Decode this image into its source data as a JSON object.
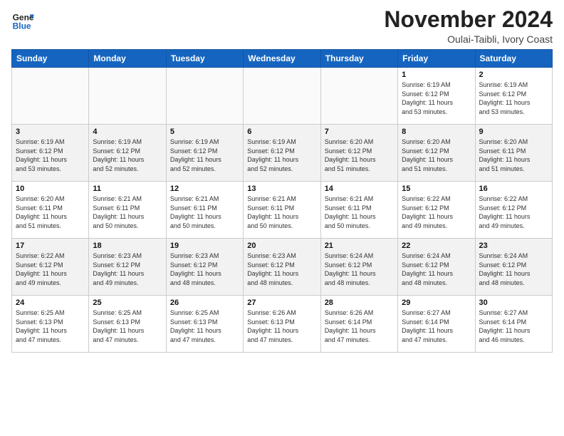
{
  "header": {
    "logo_line1": "General",
    "logo_line2": "Blue",
    "month": "November 2024",
    "location": "Oulai-Taibli, Ivory Coast"
  },
  "weekdays": [
    "Sunday",
    "Monday",
    "Tuesday",
    "Wednesday",
    "Thursday",
    "Friday",
    "Saturday"
  ],
  "weeks": [
    [
      {
        "day": "",
        "info": ""
      },
      {
        "day": "",
        "info": ""
      },
      {
        "day": "",
        "info": ""
      },
      {
        "day": "",
        "info": ""
      },
      {
        "day": "",
        "info": ""
      },
      {
        "day": "1",
        "info": "Sunrise: 6:19 AM\nSunset: 6:12 PM\nDaylight: 11 hours\nand 53 minutes."
      },
      {
        "day": "2",
        "info": "Sunrise: 6:19 AM\nSunset: 6:12 PM\nDaylight: 11 hours\nand 53 minutes."
      }
    ],
    [
      {
        "day": "3",
        "info": "Sunrise: 6:19 AM\nSunset: 6:12 PM\nDaylight: 11 hours\nand 53 minutes."
      },
      {
        "day": "4",
        "info": "Sunrise: 6:19 AM\nSunset: 6:12 PM\nDaylight: 11 hours\nand 52 minutes."
      },
      {
        "day": "5",
        "info": "Sunrise: 6:19 AM\nSunset: 6:12 PM\nDaylight: 11 hours\nand 52 minutes."
      },
      {
        "day": "6",
        "info": "Sunrise: 6:19 AM\nSunset: 6:12 PM\nDaylight: 11 hours\nand 52 minutes."
      },
      {
        "day": "7",
        "info": "Sunrise: 6:20 AM\nSunset: 6:12 PM\nDaylight: 11 hours\nand 51 minutes."
      },
      {
        "day": "8",
        "info": "Sunrise: 6:20 AM\nSunset: 6:12 PM\nDaylight: 11 hours\nand 51 minutes."
      },
      {
        "day": "9",
        "info": "Sunrise: 6:20 AM\nSunset: 6:11 PM\nDaylight: 11 hours\nand 51 minutes."
      }
    ],
    [
      {
        "day": "10",
        "info": "Sunrise: 6:20 AM\nSunset: 6:11 PM\nDaylight: 11 hours\nand 51 minutes."
      },
      {
        "day": "11",
        "info": "Sunrise: 6:21 AM\nSunset: 6:11 PM\nDaylight: 11 hours\nand 50 minutes."
      },
      {
        "day": "12",
        "info": "Sunrise: 6:21 AM\nSunset: 6:11 PM\nDaylight: 11 hours\nand 50 minutes."
      },
      {
        "day": "13",
        "info": "Sunrise: 6:21 AM\nSunset: 6:11 PM\nDaylight: 11 hours\nand 50 minutes."
      },
      {
        "day": "14",
        "info": "Sunrise: 6:21 AM\nSunset: 6:11 PM\nDaylight: 11 hours\nand 50 minutes."
      },
      {
        "day": "15",
        "info": "Sunrise: 6:22 AM\nSunset: 6:12 PM\nDaylight: 11 hours\nand 49 minutes."
      },
      {
        "day": "16",
        "info": "Sunrise: 6:22 AM\nSunset: 6:12 PM\nDaylight: 11 hours\nand 49 minutes."
      }
    ],
    [
      {
        "day": "17",
        "info": "Sunrise: 6:22 AM\nSunset: 6:12 PM\nDaylight: 11 hours\nand 49 minutes."
      },
      {
        "day": "18",
        "info": "Sunrise: 6:23 AM\nSunset: 6:12 PM\nDaylight: 11 hours\nand 49 minutes."
      },
      {
        "day": "19",
        "info": "Sunrise: 6:23 AM\nSunset: 6:12 PM\nDaylight: 11 hours\nand 48 minutes."
      },
      {
        "day": "20",
        "info": "Sunrise: 6:23 AM\nSunset: 6:12 PM\nDaylight: 11 hours\nand 48 minutes."
      },
      {
        "day": "21",
        "info": "Sunrise: 6:24 AM\nSunset: 6:12 PM\nDaylight: 11 hours\nand 48 minutes."
      },
      {
        "day": "22",
        "info": "Sunrise: 6:24 AM\nSunset: 6:12 PM\nDaylight: 11 hours\nand 48 minutes."
      },
      {
        "day": "23",
        "info": "Sunrise: 6:24 AM\nSunset: 6:12 PM\nDaylight: 11 hours\nand 48 minutes."
      }
    ],
    [
      {
        "day": "24",
        "info": "Sunrise: 6:25 AM\nSunset: 6:13 PM\nDaylight: 11 hours\nand 47 minutes."
      },
      {
        "day": "25",
        "info": "Sunrise: 6:25 AM\nSunset: 6:13 PM\nDaylight: 11 hours\nand 47 minutes."
      },
      {
        "day": "26",
        "info": "Sunrise: 6:25 AM\nSunset: 6:13 PM\nDaylight: 11 hours\nand 47 minutes."
      },
      {
        "day": "27",
        "info": "Sunrise: 6:26 AM\nSunset: 6:13 PM\nDaylight: 11 hours\nand 47 minutes."
      },
      {
        "day": "28",
        "info": "Sunrise: 6:26 AM\nSunset: 6:14 PM\nDaylight: 11 hours\nand 47 minutes."
      },
      {
        "day": "29",
        "info": "Sunrise: 6:27 AM\nSunset: 6:14 PM\nDaylight: 11 hours\nand 47 minutes."
      },
      {
        "day": "30",
        "info": "Sunrise: 6:27 AM\nSunset: 6:14 PM\nDaylight: 11 hours\nand 46 minutes."
      }
    ]
  ]
}
